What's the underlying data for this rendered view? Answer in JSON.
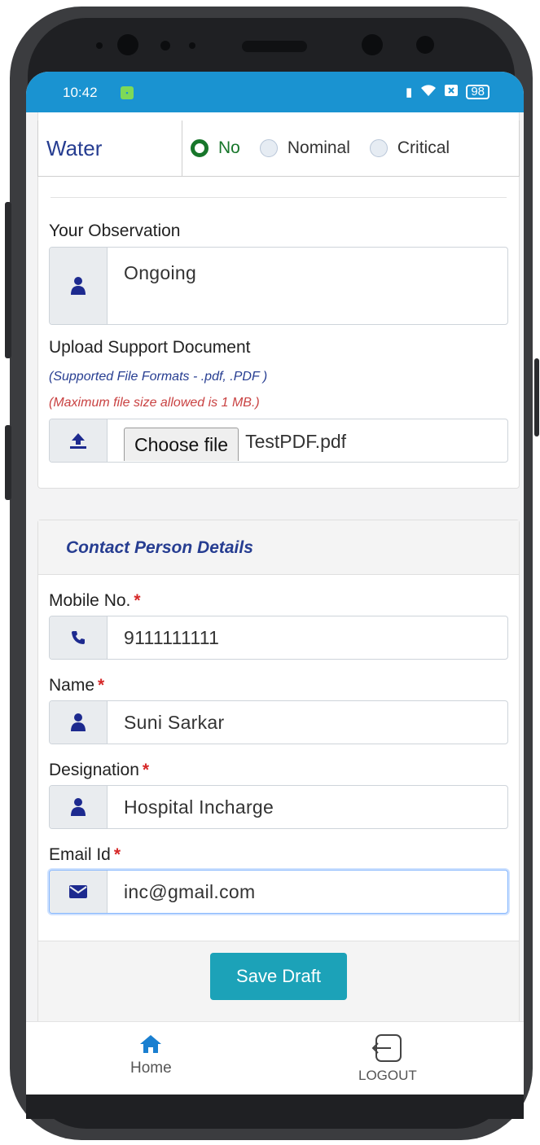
{
  "status_bar": {
    "time": "10:42",
    "battery": "98"
  },
  "water_row": {
    "label": "Water",
    "options": [
      {
        "label": "No",
        "selected": true
      },
      {
        "label": "Nominal",
        "selected": false
      },
      {
        "label": "Critical",
        "selected": false
      }
    ]
  },
  "observation": {
    "label": "Your Observation",
    "value": "Ongoing",
    "icon": "user-icon"
  },
  "upload": {
    "label": "Upload Support Document",
    "formats_hint": "(Supported File Formats - .pdf, .PDF )",
    "size_hint": "(Maximum file size allowed is 1 MB.)",
    "button_label": "Choose file",
    "file_name": "TestPDF.pdf",
    "icon": "upload-icon"
  },
  "contact": {
    "title": "Contact Person Details",
    "mobile": {
      "label": "Mobile No.",
      "required": "*",
      "value": "9111111111",
      "icon": "phone-icon"
    },
    "name": {
      "label": "Name",
      "required": "*",
      "value": "Suni Sarkar",
      "icon": "user-icon"
    },
    "designation": {
      "label": "Designation",
      "required": "*",
      "value": "Hospital Incharge",
      "icon": "user-icon"
    },
    "email": {
      "label": "Email Id",
      "required": "*",
      "value": "inc@gmail.com",
      "icon": "envelope-icon"
    },
    "save_label": "Save Draft"
  },
  "bottom_nav": {
    "home_label": "Home",
    "logout_label": "LOGOUT"
  },
  "colors": {
    "status_bar": "#1a93d1",
    "primary_text": "#263d91",
    "selected_radio": "#17762a",
    "save_button": "#1ca2b8",
    "required": "#d62828",
    "nav_icon": "#1a7fd0"
  }
}
